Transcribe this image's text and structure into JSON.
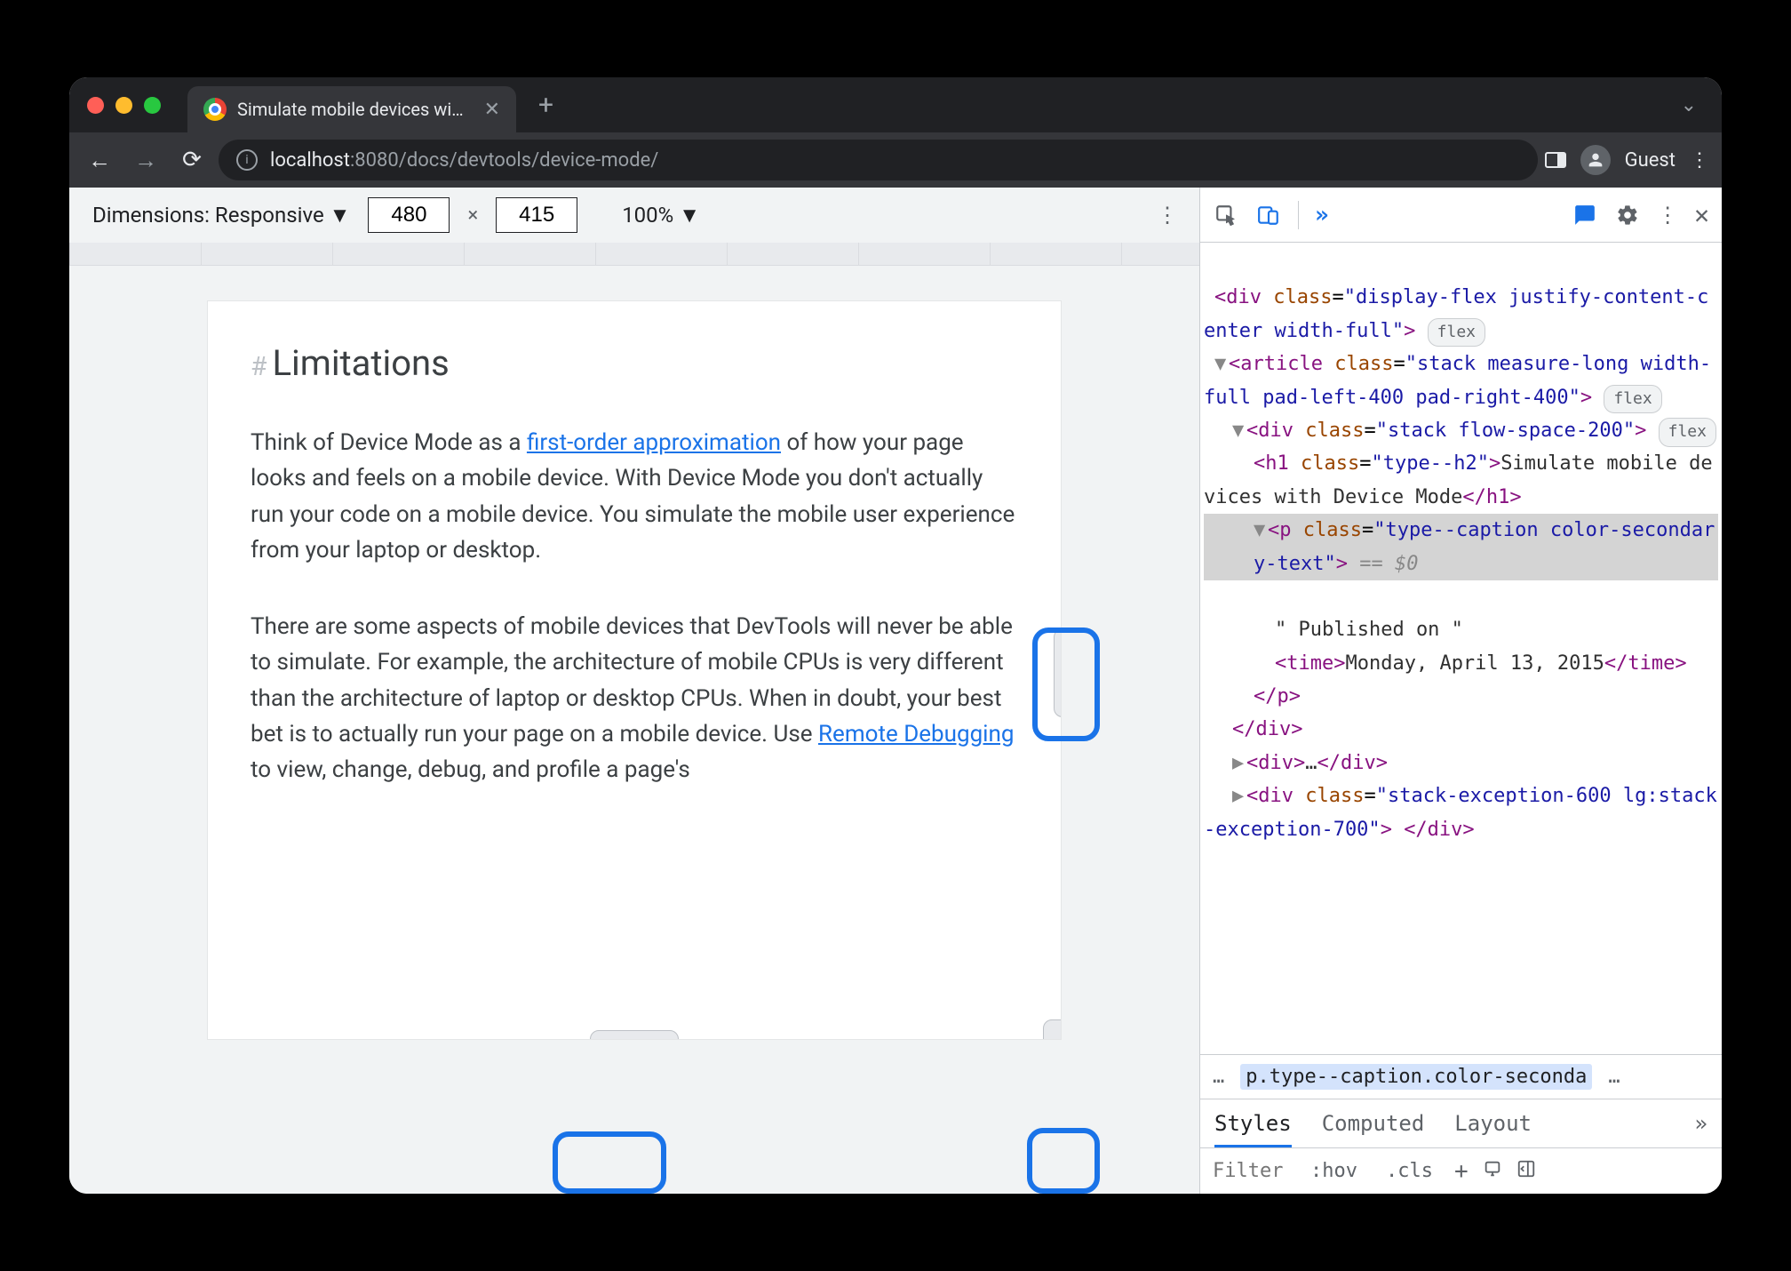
{
  "tab": {
    "title": "Simulate mobile devices with D",
    "url_host": "localhost",
    "url_port": ":8080",
    "url_path": "/docs/devtools/device-mode/",
    "profile": "Guest"
  },
  "device_toolbar": {
    "dimensions_label": "Dimensions: Responsive",
    "width": "480",
    "height": "415",
    "x": "×",
    "zoom": "100%"
  },
  "document": {
    "heading_hash": "#",
    "heading": "Limitations",
    "p1_pre": "Think of Device Mode as a ",
    "p1_link": "first-order approximation",
    "p1_post": " of how your page looks and feels on a mobile device. With Device Mode you don't actually run your code on a mobile device. You simulate the mobile user experience from your laptop or desktop.",
    "p2_pre": "There are some aspects of mobile devices that DevTools will never be able to simulate. For example, the architecture of mobile CPUs is very different than the architecture of laptop or desktop CPUs. When in doubt, your best bet is to actually run your page on a mobile device. Use ",
    "p2_link": "Remote Debugging",
    "p2_post": " to view, change, debug, and profile a page's"
  },
  "devtools": {
    "elements": {
      "l1": "div class=\"display-flex justify-content-center width-full\">",
      "flex_pill": "flex",
      "l2_open": "<article class=\"stack measure-long width-full pad-left-400 pad-right-400\">",
      "l3_open": "<div class=\"stack flow-space-200\">",
      "h1_open": "<h1 class=\"type--h2\">",
      "h1_text": "Simulate mobile devices with Device Mode",
      "h1_close": "</h1>",
      "p_open": "<p class=\"type--caption color-secondary-text\">",
      "p_eqzero": " == $0",
      "p_text1": "\" Published on \"",
      "time_open": "<time>",
      "time_text": "Monday, April 13, 2015",
      "time_close": "</time>",
      "p_close": "</p>",
      "div_close": "</div>",
      "div_ellipsis": "<div>…</div>",
      "div_exc": "<div class=\"stack-exception-600 lg:stack-exception-700\"> </div>"
    },
    "crumbs": {
      "left": "…",
      "selected": "p.type--caption.color-seconda",
      "right": "…"
    },
    "styles_tabs": {
      "styles": "Styles",
      "computed": "Computed",
      "layout": "Layout"
    },
    "styles_toolbar": {
      "filter_placeholder": "Filter",
      "hov": ":hov",
      "cls": ".cls"
    }
  }
}
